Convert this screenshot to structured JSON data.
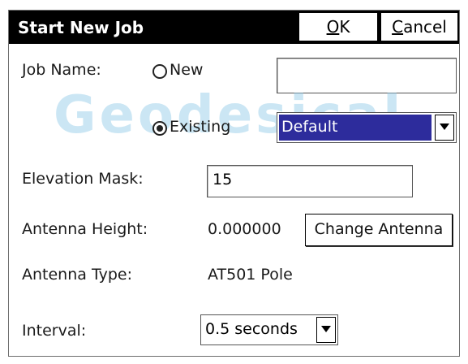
{
  "window": {
    "title": "Start New Job",
    "ok_accel": "O",
    "ok_rest": "K",
    "cancel_accel": "C",
    "cancel_rest": "ancel"
  },
  "watermark": "Geodesical",
  "job_name": {
    "label": "Job Name:",
    "option_new": "New",
    "option_existing": "Existing",
    "selected_option": "Existing",
    "new_name_value": "",
    "existing_selected": "Default"
  },
  "elevation_mask": {
    "label": "Elevation Mask:",
    "value": "15"
  },
  "antenna_height": {
    "label": "Antenna Height:",
    "value": "0.000000",
    "change_button": "Change Antenna"
  },
  "antenna_type": {
    "label": "Antenna Type:",
    "value": "AT501 Pole"
  },
  "interval": {
    "label": "Interval:",
    "selected": "0.5 seconds"
  },
  "colors": {
    "titlebar": "#000000",
    "selection": "#2d2c9c",
    "watermark": "#8cc8e6"
  },
  "icons": [
    "dropdown-arrow-icon",
    "radio-icon"
  ]
}
